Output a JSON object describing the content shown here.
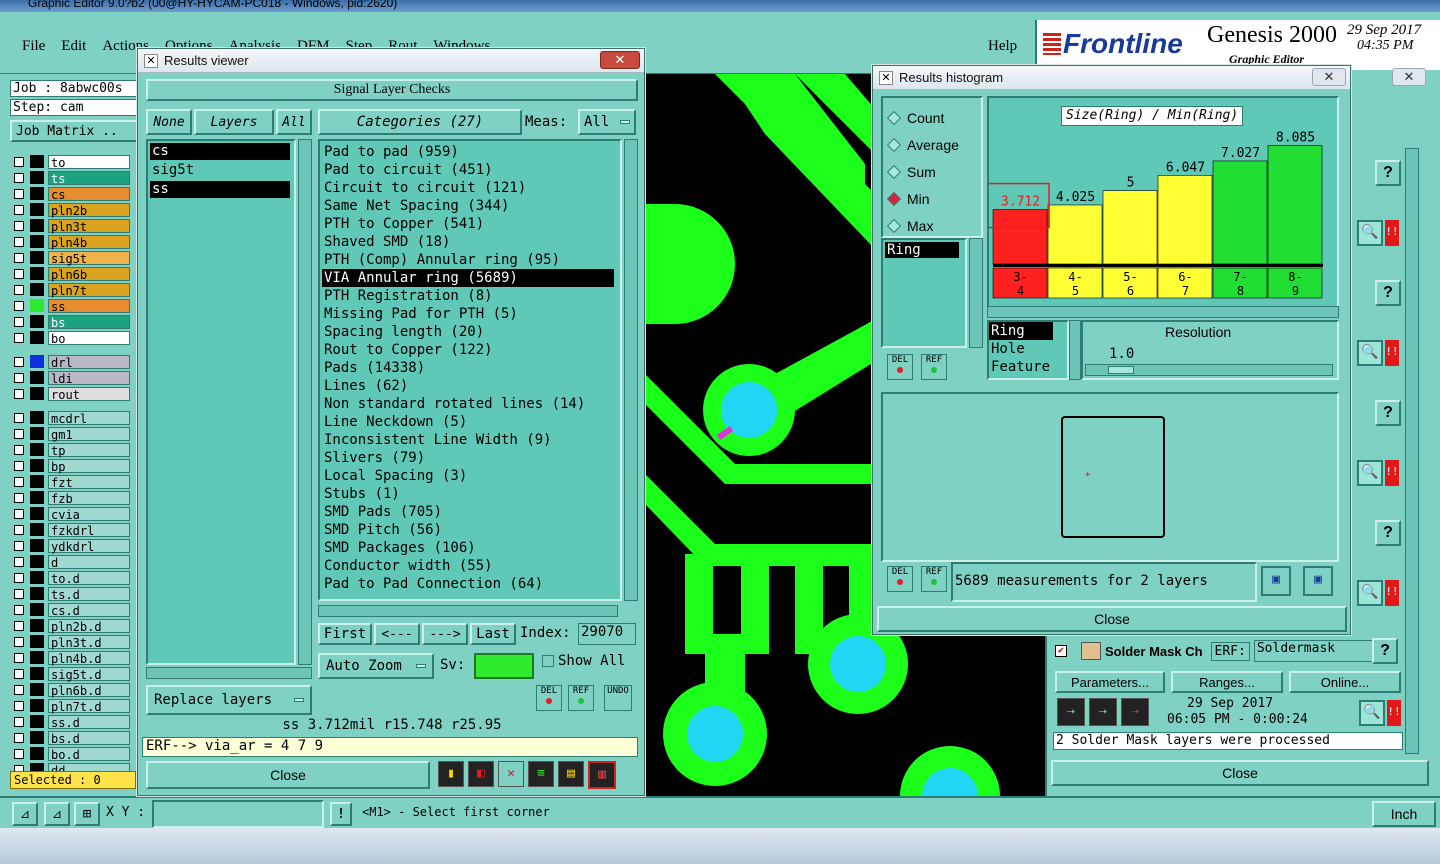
{
  "app_title": "Graphic Editor 9.0?b2 (00@HY-HYCAM-PC018 - Windows, pid:2620)",
  "menu": [
    "File",
    "Edit",
    "Actions",
    "Options",
    "Analysis",
    "DFM",
    "Step",
    "Rout",
    "Windows"
  ],
  "help": "Help",
  "brand": {
    "logo": "Frontline",
    "product": "Genesis 2000",
    "subtitle": "Graphic Editor",
    "date": "29 Sep 2017",
    "time": "04:35 PM"
  },
  "job": {
    "job": "Job : 8abwc00s",
    "step": "Step: cam",
    "matrix": "Job Matrix .."
  },
  "layers": [
    "to",
    "ts",
    "cs",
    "pln2b",
    "pln3t",
    "pln4b",
    "sig5t",
    "pln6b",
    "pln7t",
    "ss",
    "bs",
    "bo",
    "drl",
    "ldi",
    "rout",
    "mcdrl",
    "gm1",
    "tp",
    "bp",
    "fzt",
    "fzb",
    "cvia",
    "fzkdrl",
    "ydkdrl",
    "d",
    "to.d",
    "ts.d",
    "cs.d",
    "pln2b.d",
    "pln3t.d",
    "pln4b.d",
    "sig5t.d",
    "pln6b.d",
    "pln7t.d",
    "ss.d",
    "bs.d",
    "bo.d",
    "dd..."
  ],
  "layer_colors": {
    "to": "#ffffff",
    "ts": "#1aa37c",
    "cs": "#e88d2f",
    "pln2b": "#d9a21f",
    "pln3t": "#d9a21f",
    "pln4b": "#d9a21f",
    "sig5t": "#f0b24a",
    "pln6b": "#d9a21f",
    "pln7t": "#d9a21f",
    "ss": "#e88d2f",
    "bs": "#1aa37c",
    "bo": "#ffffff",
    "drl": "#b8b8c6",
    "ldi": "#b8b8c6",
    "rout": "#dedede",
    "default": "#9fd9d0"
  },
  "selected": "Selected : 0",
  "coord_bar": {
    "xy": "X Y :",
    "hint": "<M1> - Select first corner",
    "units": "Inch"
  },
  "results_viewer": {
    "title": "Results viewer",
    "header": "Signal Layer Checks",
    "none": "None",
    "layers": "Layers",
    "all": "All",
    "layer_items": [
      "cs",
      "sig5t",
      "ss"
    ],
    "categories_label": "Categories (27)",
    "meas_label": "Meas:",
    "meas_value": "All",
    "categories": [
      "Pad to pad (959)",
      "Pad to circuit (451)",
      "Circuit to circuit (121)",
      "Same Net Spacing (344)",
      "PTH to Copper (541)",
      "Shaved SMD (18)",
      "PTH (Comp) Annular ring (95)",
      "VIA Annular ring (5689)",
      "PTH Registration (8)",
      "Missing Pad for PTH (5)",
      "Spacing length (20)",
      "Rout to Copper (122)",
      "Pads (14338)",
      "Lines (62)",
      "Non standard rotated lines (14)",
      "Line Neckdown (5)",
      "Inconsistent Line Width (9)",
      "Slivers (79)",
      "Local Spacing (3)",
      "Stubs (1)",
      "SMD Pads (705)",
      "SMD Pitch (56)",
      "SMD Packages (106)",
      "Conductor width (55)",
      "Pad to Pad Connection (64)"
    ],
    "selected_category": "VIA Annular ring (5689)",
    "first": "First",
    "prev": "<---",
    "next": "--->",
    "last": "Last",
    "index_label": "Index:",
    "index_value": "29070",
    "auto_zoom": "Auto Zoom",
    "sv": "Sv:",
    "show_all": "Show All",
    "replace_layers": "Replace layers",
    "status": "ss 3.712mil  r15.748  r25.95",
    "erf": "ERF--> via_ar = 4 7 9",
    "close": "Close",
    "del": "DEL",
    "ref": "REF",
    "undo": "UNDO"
  },
  "histogram": {
    "title": "Results histogram",
    "modes": [
      "Count",
      "Average",
      "Sum",
      "Min",
      "Max"
    ],
    "selected_mode": "Min",
    "chart_title": "Size(Ring) / Min(Ring)",
    "ring_item": "Ring",
    "resolution_items": [
      "Ring",
      "Hole",
      "Feature"
    ],
    "resolution_label": "Resolution",
    "resolution_value": "1.0",
    "measurements": "5689 measurements for 2 layers",
    "close": "Close",
    "del": "DEL",
    "ref": "REF"
  },
  "chart_data": {
    "type": "bar",
    "title": "Size(Ring) / Min(Ring)",
    "categories": [
      "3-\n4",
      "4-\n5",
      "5-\n6",
      "6-\n7",
      "7-\n8",
      "8-\n9"
    ],
    "values": [
      3.712,
      4.025,
      5,
      6.047,
      7.027,
      8.085
    ],
    "colors": [
      "#ff2020",
      "#ffff33",
      "#ffff33",
      "#ffff33",
      "#22dd33",
      "#22dd33"
    ],
    "ylim": [
      0,
      9
    ],
    "grid": false
  },
  "right_panel": {
    "solder_mask": "Solder Mask Ch",
    "erf_label": "ERF:",
    "erf_value": "Soldermask",
    "parameters": "Parameters...",
    "ranges": "Ranges...",
    "online": "Online...",
    "date": "29 Sep 2017",
    "time": "06:05 PM - 0:00:24",
    "message": "2 Solder Mask layers were processed",
    "close": "Close",
    "question": "?"
  }
}
